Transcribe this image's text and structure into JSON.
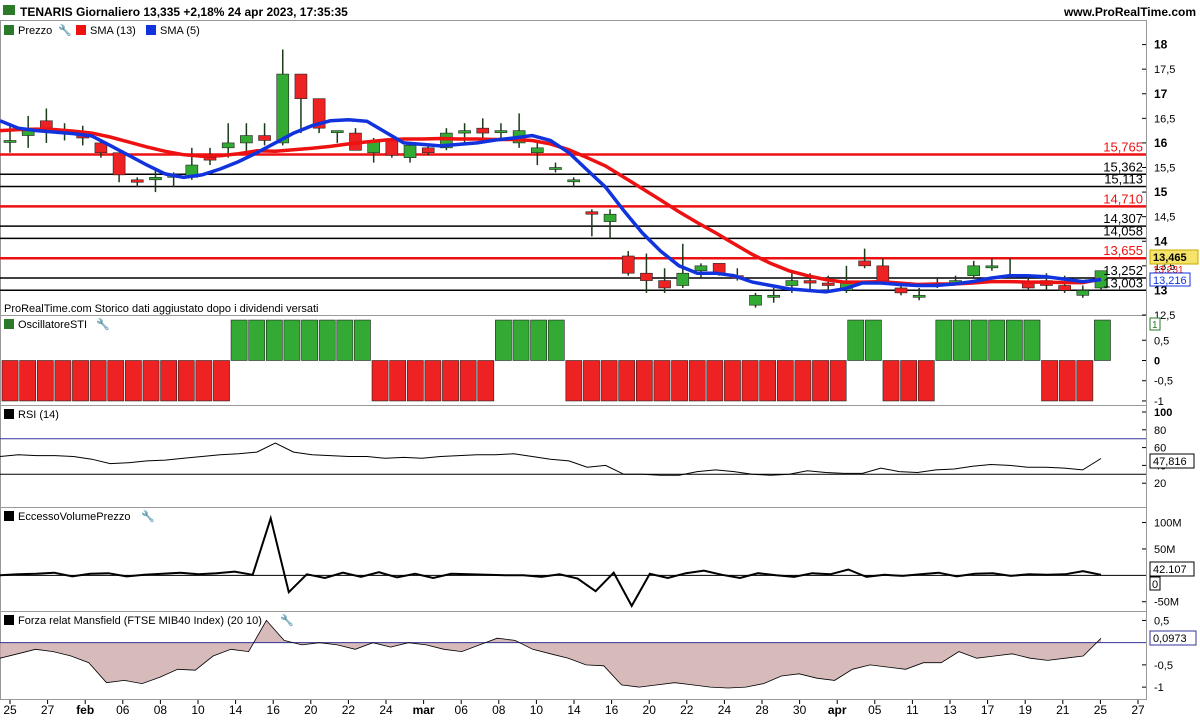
{
  "header": {
    "title": "TENARIS Giornaliero 13,335 +2,18% 24 apr 2023, 17:35:35",
    "site": "www.ProRealTime.com"
  },
  "price_panel": {
    "legend": [
      "Prezzo",
      "SMA (13)",
      "SMA (5)"
    ],
    "footnote": "ProRealTime.com Storico dati aggiustato dopo i dividendi versati",
    "last_price_label": "13,465",
    "sma5_label": "13,216",
    "sma13_label": "13,231"
  },
  "sti_panel": {
    "legend": "OscillatoreSTI",
    "value_label": "1"
  },
  "rsi_panel": {
    "legend": "RSI (14)",
    "value_label": "47,816"
  },
  "vol_panel": {
    "legend": "EccessoVolumePrezzo",
    "value_label": "42.107",
    "zero_label": "0"
  },
  "mansfield_panel": {
    "legend": "Forza relat Mansfield (FTSE MIB40 Index) (20 10)",
    "value_label": "0,0973"
  },
  "colors": {
    "up": "#33aa33",
    "down": "#ee2222",
    "sma13": "#ee1111",
    "sma5": "#1133dd",
    "resistance_red": "#ee1111",
    "support_black": "#000000",
    "rsi_band": "#333399",
    "mansfield_fill": "#c9a3a3"
  },
  "chart_data": [
    {
      "type": "candlestick",
      "x": [
        "25 gen",
        "27 gen",
        "30 gen",
        "31 gen",
        "01 feb",
        "02 feb",
        "03 feb",
        "06 feb",
        "07 feb",
        "08 feb",
        "09 feb",
        "10 feb",
        "13 feb",
        "14 feb",
        "15 feb",
        "16 feb",
        "17 feb",
        "20 feb",
        "21 feb",
        "22 feb",
        "23 feb",
        "24 feb",
        "27 feb",
        "28 feb",
        "01 mar",
        "02 mar",
        "03 mar",
        "06 mar",
        "07 mar",
        "08 mar",
        "09 mar",
        "10 mar",
        "13 mar",
        "14 mar",
        "15 mar",
        "16 mar",
        "17 mar",
        "20 mar",
        "21 mar",
        "22 mar",
        "23 mar",
        "24 mar",
        "27 mar",
        "28 mar",
        "29 mar",
        "30 mar",
        "31 mar",
        "03 apr",
        "04 apr",
        "05 apr",
        "06 apr",
        "11 apr",
        "12 apr",
        "13 apr",
        "14 apr",
        "17 apr",
        "18 apr",
        "19 apr",
        "20 apr",
        "21 apr",
        "24 apr"
      ],
      "open": [
        16.05,
        16.15,
        16.45,
        16.2,
        16.2,
        16.0,
        15.8,
        15.25,
        15.25,
        15.3,
        15.3,
        15.7,
        15.9,
        16.0,
        16.15,
        16.0,
        17.4,
        16.9,
        16.25,
        16.2,
        15.8,
        16.05,
        15.7,
        15.9,
        15.9,
        16.2,
        16.3,
        16.25,
        16.0,
        15.8,
        15.5,
        15.25,
        14.6,
        14.4,
        13.7,
        13.35,
        13.2,
        13.1,
        13.4,
        13.55,
        13.3,
        12.7,
        12.9,
        13.1,
        13.2,
        13.15,
        13.0,
        13.6,
        13.5,
        13.05,
        12.9,
        13.1,
        13.15,
        13.3,
        13.5,
        13.3,
        13.15,
        13.2,
        13.1,
        12.9,
        13.05
      ],
      "close": [
        16.05,
        16.25,
        16.3,
        16.25,
        16.1,
        15.8,
        15.35,
        15.2,
        15.3,
        15.35,
        15.55,
        15.65,
        16.0,
        16.15,
        16.05,
        17.4,
        16.9,
        16.3,
        16.25,
        15.85,
        16.05,
        15.75,
        15.95,
        15.8,
        16.2,
        16.25,
        16.2,
        16.25,
        16.25,
        15.9,
        15.5,
        15.25,
        14.55,
        14.55,
        13.35,
        13.2,
        13.05,
        13.35,
        13.5,
        13.35,
        13.25,
        12.9,
        12.9,
        13.2,
        13.15,
        13.1,
        13.15,
        13.5,
        13.2,
        12.95,
        12.9,
        13.15,
        13.2,
        13.5,
        13.5,
        13.3,
        13.05,
        13.1,
        13.0,
        13.0,
        13.4
      ],
      "high": [
        16.4,
        16.55,
        16.7,
        16.4,
        16.35,
        16.05,
        15.8,
        15.3,
        15.45,
        15.4,
        15.9,
        15.9,
        16.4,
        16.4,
        16.4,
        17.9,
        17.1,
        16.5,
        16.25,
        16.3,
        16.1,
        16.1,
        16.0,
        15.95,
        16.3,
        16.4,
        16.5,
        16.4,
        16.6,
        16.0,
        15.6,
        15.3,
        14.65,
        14.65,
        13.8,
        13.75,
        13.45,
        13.95,
        13.55,
        13.55,
        13.45,
        12.95,
        13.05,
        13.35,
        13.35,
        13.3,
        13.5,
        13.85,
        13.65,
        13.1,
        13.05,
        13.25,
        13.3,
        13.6,
        13.65,
        13.65,
        13.3,
        13.35,
        13.3,
        13.1,
        13.4
      ],
      "low": [
        15.8,
        15.9,
        16.0,
        16.05,
        15.95,
        15.7,
        15.2,
        15.1,
        15.0,
        15.1,
        15.25,
        15.55,
        15.7,
        15.8,
        15.95,
        15.95,
        16.2,
        16.2,
        16.0,
        15.85,
        15.6,
        15.7,
        15.6,
        15.75,
        15.85,
        16.0,
        16.1,
        16.05,
        15.9,
        15.55,
        15.4,
        15.1,
        14.1,
        14.05,
        13.3,
        12.95,
        12.95,
        13.05,
        13.25,
        13.3,
        13.2,
        12.65,
        12.75,
        12.95,
        13.0,
        13.0,
        12.95,
        13.45,
        13.2,
        12.9,
        12.8,
        13.05,
        13.1,
        13.25,
        13.4,
        13.25,
        13.0,
        13.0,
        12.95,
        12.85,
        13.0
      ]
    },
    {
      "type": "line",
      "title": "SMA (13)",
      "y": [
        16.25,
        16.27,
        16.28,
        16.27,
        16.24,
        16.2,
        16.12,
        16.02,
        15.92,
        15.83,
        15.76,
        15.73,
        15.74,
        15.78,
        15.84,
        15.83,
        15.86,
        15.89,
        15.93,
        15.98,
        16.02,
        16.06,
        16.08,
        16.08,
        16.09,
        16.08,
        16.08,
        16.07,
        16.07,
        16.05,
        15.98,
        15.86,
        15.7,
        15.53,
        15.3,
        15.07,
        14.84,
        14.6,
        14.38,
        14.17,
        13.95,
        13.73,
        13.55,
        13.4,
        13.3,
        13.22,
        13.17,
        13.17,
        13.18,
        13.15,
        13.12,
        13.13,
        13.13,
        13.15,
        13.18,
        13.18,
        13.17,
        13.17,
        13.16,
        13.16,
        13.23
      ]
    },
    {
      "type": "line",
      "title": "SMA (5)",
      "y": [
        16.45,
        16.3,
        16.25,
        16.22,
        16.19,
        16.14,
        15.95,
        15.75,
        15.55,
        15.37,
        15.3,
        15.35,
        15.47,
        15.62,
        15.8,
        16.0,
        16.2,
        16.35,
        16.45,
        16.47,
        16.44,
        16.22,
        16.0,
        15.97,
        15.94,
        15.97,
        16.0,
        16.06,
        16.1,
        16.15,
        16.05,
        15.8,
        15.45,
        15.1,
        14.62,
        14.17,
        13.8,
        13.5,
        13.35,
        13.35,
        13.3,
        13.17,
        13.1,
        13.03,
        13.0,
        12.97,
        13.03,
        13.15,
        13.15,
        13.12,
        13.1,
        13.1,
        13.13,
        13.18,
        13.25,
        13.3,
        13.3,
        13.28,
        13.23,
        13.18,
        13.22
      ]
    },
    {
      "type": "hlines",
      "red_levels": [
        15.765,
        14.71,
        13.655
      ],
      "red_labels": [
        "15,765",
        "14,710",
        "13,655"
      ],
      "black_levels": [
        15.362,
        15.113,
        14.307,
        14.058,
        13.252,
        13.003
      ],
      "black_labels": [
        "15,362",
        "15,113",
        "14,307",
        "14,058",
        "13,252",
        "13,003"
      ],
      "ylim": [
        12.5,
        18.5
      ],
      "yticks": [
        12.5,
        13,
        13.5,
        14,
        14.5,
        15,
        15.5,
        16,
        16.5,
        17,
        17.5,
        18
      ],
      "ytick_labels": [
        "12,5",
        "13",
        "13,5",
        "14",
        "14,5",
        "15",
        "15,5",
        "16",
        "16,5",
        "17",
        "17,5",
        "18"
      ]
    },
    {
      "type": "bar",
      "title": "OscillatoreSTI",
      "values": [
        -1,
        -1,
        -1,
        -1,
        -1,
        -1,
        -1,
        -1,
        -1,
        -1,
        -1,
        -1,
        -1,
        1,
        1,
        1,
        1,
        1,
        1,
        1,
        1,
        -1,
        -1,
        -1,
        -1,
        -1,
        -1,
        -1,
        1,
        1,
        1,
        1,
        -1,
        -1,
        -1,
        -1,
        -1,
        -1,
        -1,
        -1,
        -1,
        -1,
        -1,
        -1,
        -1,
        -1,
        -1,
        -1,
        1,
        1,
        -1,
        -1,
        -1,
        1,
        1,
        1,
        1,
        1,
        1,
        -1,
        -1,
        -1,
        1
      ],
      "ylim": [
        -1.1,
        1.1
      ],
      "yticks": [
        1,
        0.5,
        0,
        -0.5,
        -1
      ],
      "ytick_labels": [
        "1",
        "0,5",
        "0",
        "-0,5",
        "-1"
      ]
    },
    {
      "type": "line",
      "title": "RSI (14)",
      "y": [
        50,
        52,
        51,
        51,
        50,
        47,
        42,
        43,
        45,
        46,
        48,
        50,
        52,
        53,
        55,
        65,
        55,
        52,
        51,
        50,
        50,
        48,
        49,
        48,
        50,
        51,
        52,
        52,
        53,
        50,
        47,
        45,
        38,
        40,
        30,
        30,
        29,
        29,
        33,
        35,
        33,
        30,
        29,
        30,
        34,
        32,
        31,
        31,
        37,
        33,
        32,
        35,
        36,
        39,
        41,
        40,
        38,
        38,
        37,
        35,
        47.8
      ],
      "ylim": [
        0,
        100
      ],
      "bands": [
        70,
        30
      ],
      "yticks": [
        100,
        80,
        60,
        40,
        20
      ],
      "ytick_labels": [
        "100",
        "80",
        "60",
        "40",
        "20"
      ]
    },
    {
      "type": "line",
      "title": "EccessoVolumePrezzo",
      "y": [
        0,
        2,
        3,
        5,
        -2,
        3,
        4,
        -2,
        1,
        3,
        5,
        2,
        4,
        7,
        1,
        108,
        -32,
        2,
        -5,
        5,
        -3,
        6,
        -4,
        3,
        -5,
        3,
        2,
        1,
        0,
        0,
        -3,
        2,
        -6,
        -30,
        5,
        -58,
        3,
        -5,
        4,
        9,
        1,
        -5,
        4,
        0,
        -3,
        4,
        2,
        11,
        -3,
        1,
        -1,
        2,
        5,
        -2,
        3,
        4,
        -1,
        2,
        1,
        2,
        8,
        1
      ],
      "ylim": [
        -60,
        120
      ],
      "yticks": [
        100,
        50,
        0,
        -50
      ],
      "ytick_labels": [
        "100M",
        "50M",
        "0",
        "-50M"
      ]
    },
    {
      "type": "area",
      "title": "Forza relat Mansfield (FTSE MIB40 Index) (20 10)",
      "y": [
        -0.35,
        -0.25,
        -0.15,
        -0.2,
        -0.3,
        -0.45,
        -0.9,
        -0.85,
        -0.92,
        -0.78,
        -0.6,
        -0.62,
        -0.3,
        -0.15,
        -0.2,
        0.5,
        0.05,
        -0.05,
        0,
        -0.05,
        -0.15,
        0,
        -0.1,
        0,
        -0.05,
        -0.15,
        -0.2,
        -0.05,
        0.1,
        0.05,
        -0.15,
        -0.25,
        -0.35,
        -0.5,
        -0.52,
        -0.95,
        -1.0,
        -0.95,
        -0.9,
        -0.95,
        -1.0,
        -1.02,
        -1.0,
        -0.92,
        -0.75,
        -0.7,
        -0.8,
        -0.85,
        -0.6,
        -0.5,
        -0.55,
        -0.6,
        -0.45,
        -0.45,
        -0.2,
        -0.35,
        -0.3,
        -0.25,
        -0.35,
        -0.4,
        -0.35,
        -0.3,
        0.0973
      ],
      "ylim": [
        -1.2,
        0.6
      ],
      "yticks": [
        0.5,
        0,
        -0.5,
        -1
      ],
      "ytick_labels": [
        "0,5",
        "0",
        "-0,5",
        "-1"
      ]
    },
    {
      "type": "xaxis",
      "tick_labels": [
        "25",
        "27",
        "feb",
        "06",
        "08",
        "10",
        "14",
        "16",
        "20",
        "22",
        "24",
        "mar",
        "06",
        "08",
        "10",
        "14",
        "16",
        "20",
        "22",
        "24",
        "28",
        "30",
        "apr",
        "05",
        "11",
        "13",
        "17",
        "19",
        "21",
        "25",
        "27"
      ]
    }
  ]
}
